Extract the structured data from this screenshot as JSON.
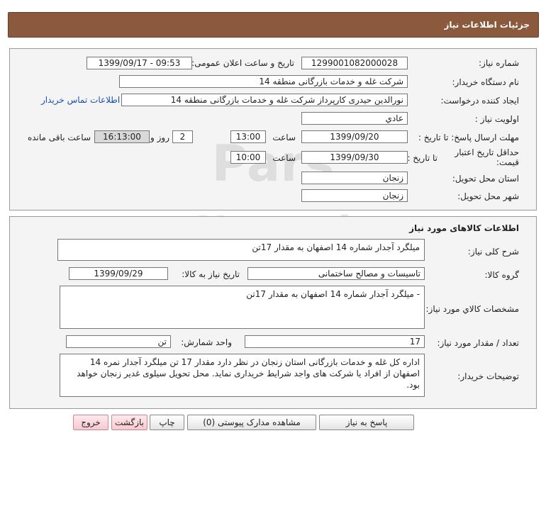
{
  "header": {
    "title": "جزئیات اطلاعات نیاز"
  },
  "info": {
    "need_number_label": "شماره نیاز:",
    "need_number": "1299001082000028",
    "announce_label": "تاریخ و ساعت اعلان عمومی:",
    "announce_value": "1399/09/17 - 09:53",
    "buyer_org_label": "نام دستگاه خریدار:",
    "buyer_org": "شرکت غله و خدمات بازرگانی منطقه 14",
    "creator_label": "ایجاد کننده درخواست:",
    "creator": "نورالدین حیدری کارپرداز شرکت غله و خدمات بازرگانی منطقه 14",
    "contact_link": "اطلاعات تماس خریدار",
    "priority_label": "اولویت نیاز :",
    "priority": "عادي",
    "send_deadline_label": "مهلت ارسال پاسخ: تا تاریخ :",
    "send_date": "1399/09/20",
    "time_label": "ساعت",
    "send_time": "13:00",
    "days_value": "2",
    "days_label": "روز و",
    "remaining_time": "16:13:00",
    "remaining_label": "ساعت باقی مانده",
    "price_validity_label": "حداقل تاریخ اعتبار قیمت:",
    "price_validity_sub": "تا تاریخ :",
    "validity_date": "1399/09/30",
    "validity_time": "10:00",
    "province_label": "استان محل تحویل:",
    "province": "زنجان",
    "city_label": "شهر محل تحویل:",
    "city": "زنجان"
  },
  "goods": {
    "title": "اطلاعات کالاهای مورد نیاز",
    "general_desc_label": "شرح کلی نیاز:",
    "general_desc": "میلگرد آجدار شماره 14 اصفهان به مقدار 17تن",
    "group_label": "گروه کالا:",
    "group": "تاسیسات و مصالح ساختمانی",
    "need_date_label": "تاریخ نیاز به کالا:",
    "need_date": "1399/09/29",
    "specs_label": "مشخصات کالاي مورد نیاز:",
    "specs": "- میلگرد آجدار شماره 14 اصفهان به مقدار 17تن",
    "qty_label": "تعداد / مقدار مورد نیاز:",
    "qty": "17",
    "unit_label": "واحد شمارش:",
    "unit": "تن",
    "buyer_notes_label": "توضیحات خریدار:",
    "buyer_notes": "اداره کل غله و خدمات بازرگانی استان زنجان در نظر دارد مقدار 17 تن میلگرد آجدار نمره 14 اصفهان از افراد یا شرکت های واجد شرایط خریداری نماید. محل تحویل سیلوی غدیر زنجان خواهد بود."
  },
  "buttons": {
    "reply": "پاسخ به نیاز",
    "attachments": "مشاهده مدارک پیوستی (0)",
    "print": "چاپ",
    "back": "بازگشت",
    "exit": "خروج"
  },
  "colors": {
    "header_bg": "#8b5a3c",
    "link": "#1a4fb0"
  }
}
